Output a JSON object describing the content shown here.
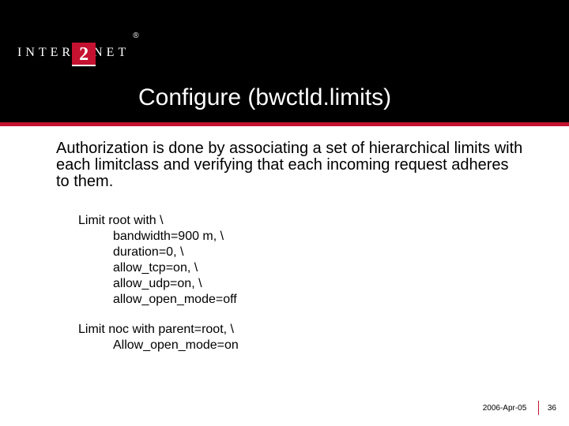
{
  "logo": {
    "part1": "INTER",
    "box": "2",
    "part2": "NET",
    "reg": "®"
  },
  "title": "Configure (bwctld.limits)",
  "intro": "Authorization is done by associating a set of hierarchical limits with each limitclass and verifying that each incoming request adheres to them.",
  "code": {
    "block1": {
      "l1": "Limit root with \\",
      "l2": "bandwidth=900 m, \\",
      "l3": "duration=0, \\",
      "l4": "allow_tcp=on, \\",
      "l5": "allow_udp=on, \\",
      "l6": "allow_open_mode=off"
    },
    "block2": {
      "l1": "Limit noc with parent=root, \\",
      "l2": "Allow_open_mode=on"
    }
  },
  "footer": {
    "date": "2006-Apr-05",
    "page": "36"
  }
}
